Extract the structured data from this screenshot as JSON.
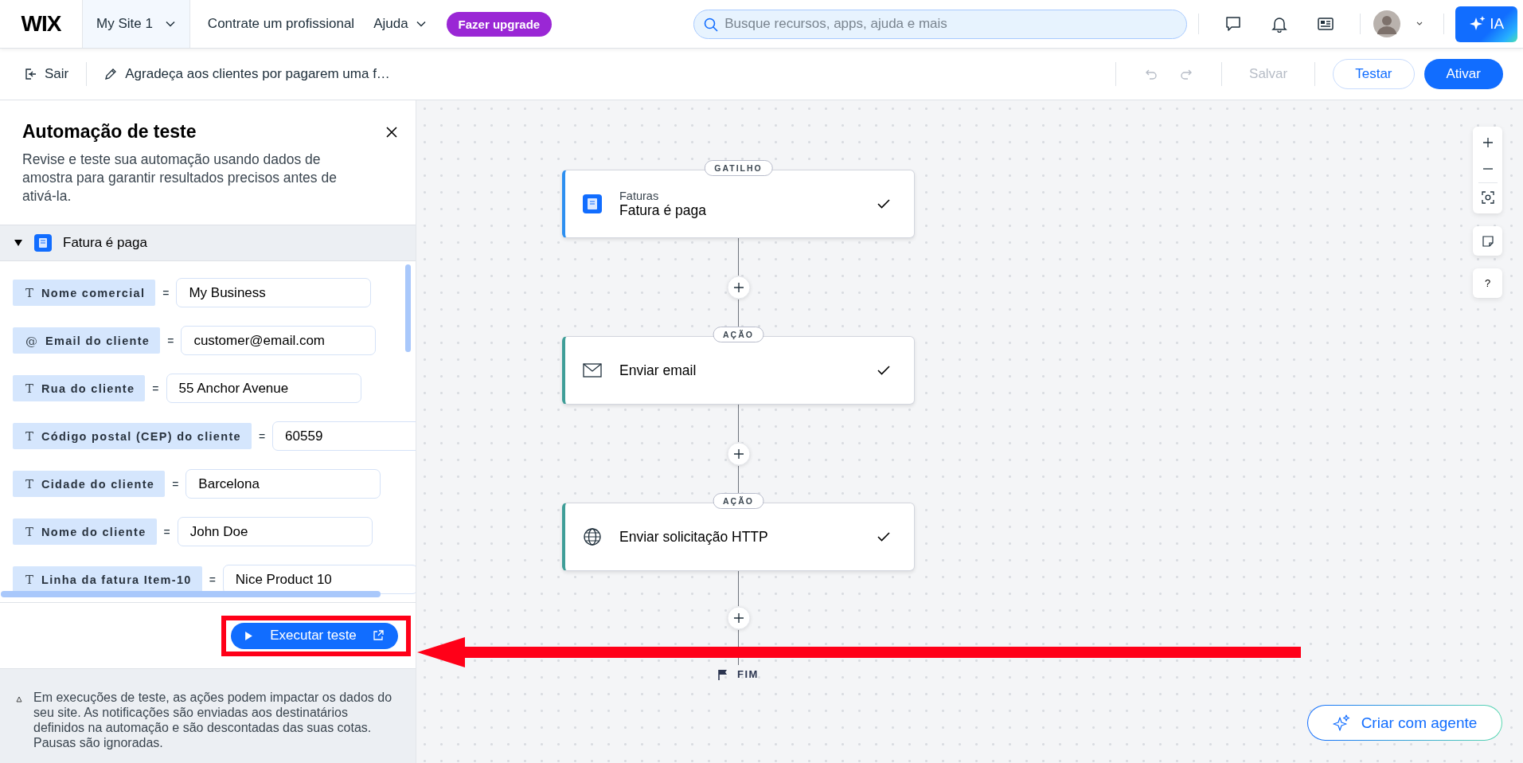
{
  "top_bar": {
    "logo": "WIX",
    "site_menu": {
      "label": "My Site 1",
      "selected": true
    },
    "nav": [
      {
        "label": "Contrate um profissional",
        "has_menu": false
      },
      {
        "label": "Ajuda",
        "has_menu": true
      }
    ],
    "upgrade_button": "Fazer upgrade",
    "search": {
      "placeholder": "Busque recursos, apps, ajuda e mais"
    },
    "ai_button": "IA"
  },
  "toolbar": {
    "exit": "Sair",
    "automation_title": "Agradeça aos clientes por pagarem uma f…",
    "undo_disabled": true,
    "redo_disabled": true,
    "save": {
      "label": "Salvar",
      "disabled": true
    },
    "test_button": "Testar",
    "activate_button": "Ativar"
  },
  "test_panel": {
    "title": "Automação de teste",
    "description": "Revise e teste sua automação usando dados de amostra para garantir resultados precisos antes de ativá-la.",
    "section": {
      "title": "Fatura é paga",
      "expanded": true
    },
    "fields": [
      {
        "symbol": "T",
        "label": "Nome comercial",
        "operator": "=",
        "value": "My Business"
      },
      {
        "symbol": "@",
        "label": "Email do cliente",
        "operator": "=",
        "value": "customer@email.com"
      },
      {
        "symbol": "T",
        "label": "Rua do cliente",
        "operator": "=",
        "value": "55 Anchor Avenue"
      },
      {
        "symbol": "T",
        "label": "Código postal (CEP) do cliente",
        "operator": "=",
        "value": "60559"
      },
      {
        "symbol": "T",
        "label": "Cidade do cliente",
        "operator": "=",
        "value": "Barcelona"
      },
      {
        "symbol": "T",
        "label": "Nome do cliente",
        "operator": "=",
        "value": "John Doe"
      },
      {
        "symbol": "T",
        "label": "Linha da fatura Item-10",
        "operator": "=",
        "value": "Nice Product 10"
      }
    ],
    "run_button": "Executar teste",
    "notice": "Em execuções de teste, as ações podem impactar os dados do seu site. As notificações são enviadas aos destinatários definidos na automação e são descontadas das suas cotas. Pausas são ignoradas."
  },
  "flow": {
    "steps": [
      {
        "kind": "trigger",
        "badge": "GATILHO",
        "category": "Faturas",
        "title": "Fatura é paga",
        "complete": true
      },
      {
        "kind": "email",
        "badge": "AÇÃO",
        "title": "Enviar email",
        "complete": true
      },
      {
        "kind": "http",
        "badge": "AÇÃO",
        "title": "Enviar solicitação HTTP",
        "complete": true
      }
    ],
    "end_label": "FIM"
  },
  "canvas_controls": {
    "help": "?"
  },
  "agent_button": "Criar com agente",
  "annotations": {
    "highlight_frame": true,
    "arrow": true
  }
}
